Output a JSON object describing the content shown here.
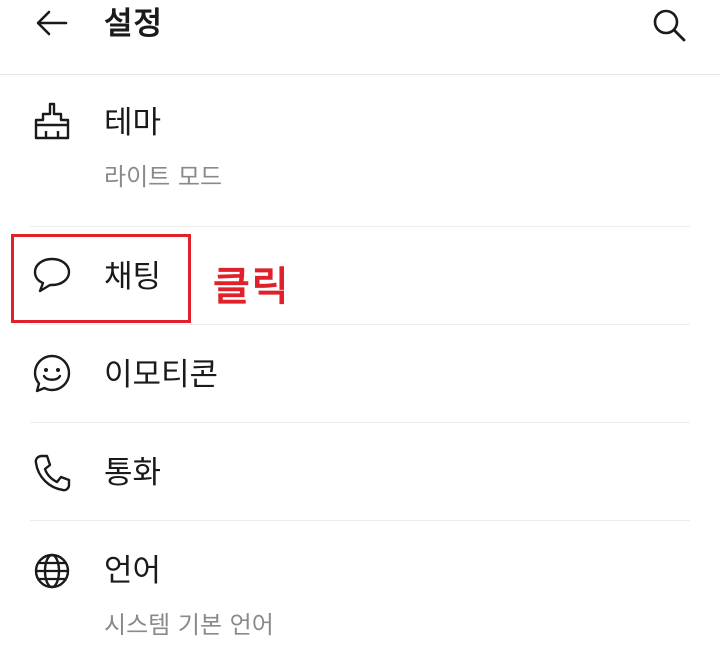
{
  "header": {
    "title": "설정",
    "back_icon": "arrow-left-icon",
    "search_icon": "search-icon"
  },
  "settings": [
    {
      "id": "theme",
      "icon": "paintbrush-icon",
      "title": "테마",
      "subtitle": "라이트 모드"
    },
    {
      "id": "chat",
      "icon": "speech-bubble-icon",
      "title": "채팅"
    },
    {
      "id": "emoticon",
      "icon": "smiley-bubble-icon",
      "title": "이모티콘"
    },
    {
      "id": "call",
      "icon": "phone-icon",
      "title": "통화"
    },
    {
      "id": "language",
      "icon": "globe-icon",
      "title": "언어",
      "subtitle": "시스템 기본 언어"
    }
  ],
  "annotation": {
    "label": "클릭",
    "color": "#e0212b"
  }
}
